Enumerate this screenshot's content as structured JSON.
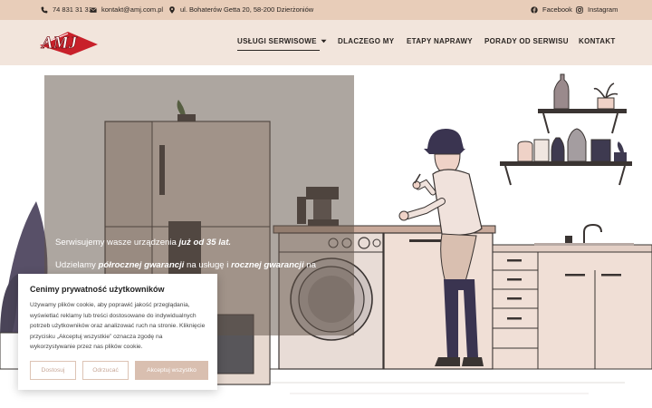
{
  "topbar": {
    "phone": "74 831 31 31",
    "email": "kontakt@amj.com.pl",
    "address": "ul. Bohaterów Getta 20, 58-200 Dzierżoniów",
    "facebook": "Facebook",
    "instagram": "Instagram"
  },
  "logo": {
    "text": "AMJ"
  },
  "nav": {
    "items": [
      {
        "label": "USŁUGI SERWISOWE"
      },
      {
        "label": "DLACZEGO MY"
      },
      {
        "label": "ETAPY NAPRAWY"
      },
      {
        "label": "PORADY OD SERWISU"
      },
      {
        "label": "KONTAKT"
      }
    ]
  },
  "hero": {
    "line1_pre": "Serwisujemy wasze urządzenia ",
    "line1_em": "już od 35 lat.",
    "line2_pre": "Udzielamy ",
    "line2_em1": "półrocznej gwarancji",
    "line2_mid": " na usługę i ",
    "line2_em2": "rocznej gwarancji",
    "line2_post": " na"
  },
  "cookie": {
    "title": "Cenimy prywatność użytkowników",
    "body": "Używamy plików cookie, aby poprawić jakość przeglądania, wyświetlać reklamy lub treści dostosowane do indywidualnych potrzeb użytkowników oraz analizować ruch na stronie. Kliknięcie przycisku „Akceptuj wszystkie” oznacza zgodę na wykorzystywanie przez nas plików cookie.",
    "customize": "Dostosuj",
    "reject": "Odrzucać",
    "accept": "Akceptuj wszystko"
  },
  "colors": {
    "topbar_bg": "#e8cdb9",
    "header_bg": "#f2e5dc",
    "logo_red": "#c8202a",
    "accent_button": "#d9bfb0"
  }
}
